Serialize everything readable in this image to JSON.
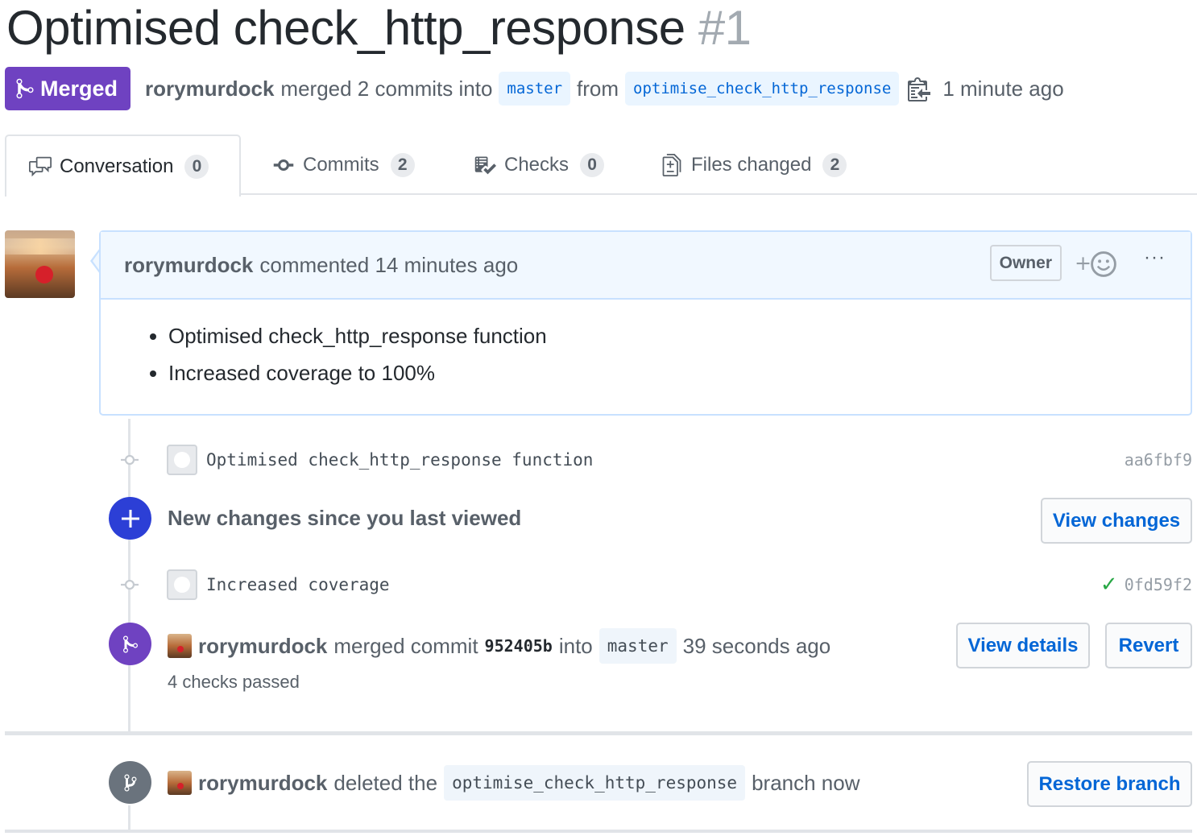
{
  "pr": {
    "title": "Optimised check_http_response",
    "number": "#1",
    "state": "Merged",
    "state_color": "#6f42c1",
    "author": "rorymurdock",
    "summary_text": "merged 2 commits into",
    "base_branch": "master",
    "from_text": "from",
    "head_branch": "optimise_check_http_response",
    "time": "1 minute ago",
    "copy_icon": "clippy-icon"
  },
  "tabs": [
    {
      "label": "Conversation",
      "count": "0",
      "icon": "comment-discussion-icon",
      "selected": true
    },
    {
      "label": "Commits",
      "count": "2",
      "icon": "git-commit-icon",
      "selected": false
    },
    {
      "label": "Checks",
      "count": "0",
      "icon": "checklist-icon",
      "selected": false
    },
    {
      "label": "Files changed",
      "count": "2",
      "icon": "file-diff-icon",
      "selected": false
    }
  ],
  "comment": {
    "author": "rorymurdock",
    "action": "commented 14 minutes ago",
    "badge": "Owner",
    "reaction_icon": "smiley-icon",
    "more_icon": "kebab-horizontal-icon",
    "more_label": "···",
    "items": [
      "Optimised check_http_response function",
      "Increased coverage to 100%"
    ]
  },
  "timeline": {
    "commits": [
      {
        "message": "Optimised check_http_response function",
        "sha": "aa6fbf9",
        "check": ""
      },
      {
        "message": "Increased coverage",
        "sha": "0fd59f2",
        "check": "✓"
      }
    ],
    "new_changes": {
      "text": "New changes since you last viewed",
      "button": "View changes",
      "color": "#2c3fd6"
    },
    "merge_event": {
      "author": "rorymurdock",
      "text1": "merged commit",
      "sha": "952405b",
      "text2": "into",
      "branch": "master",
      "time": "39 seconds ago",
      "checks": "4 checks passed",
      "details_button": "View details",
      "revert_button": "Revert",
      "color": "#6f42c1"
    },
    "delete_event": {
      "author": "rorymurdock",
      "text1": "deleted the",
      "branch": "optimise_check_http_response",
      "text2": "branch now",
      "button": "Restore branch",
      "color": "#6a737d"
    }
  }
}
